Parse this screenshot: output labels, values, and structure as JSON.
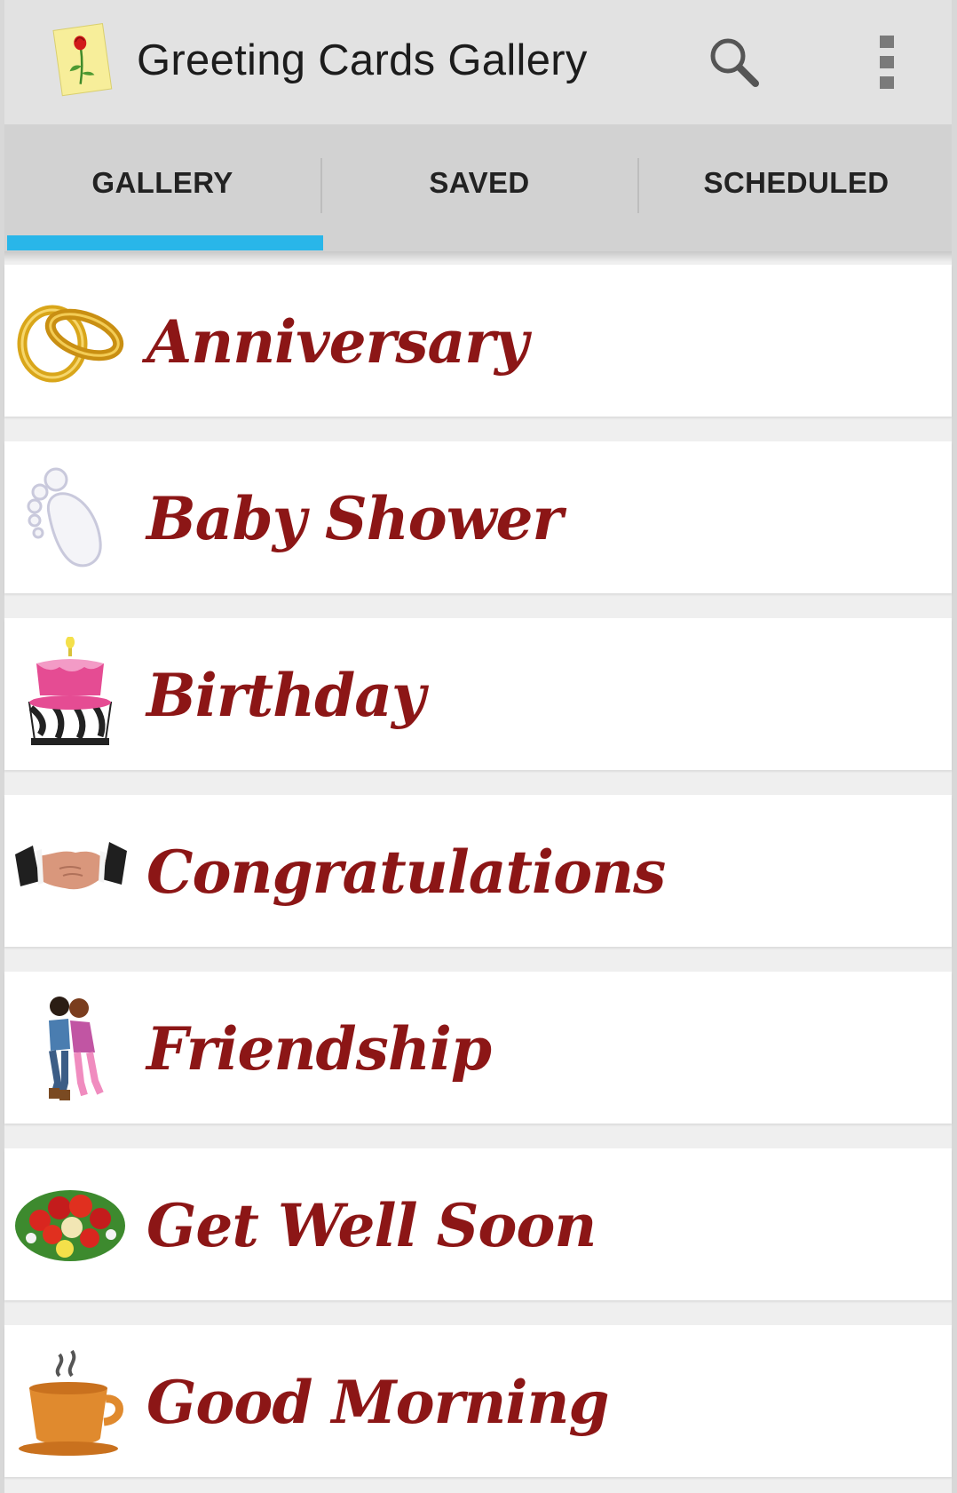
{
  "action_bar": {
    "title": "Greeting Cards Gallery",
    "logo_icon": "rose-card-icon",
    "search_icon": "search-icon",
    "menu_icon": "overflow-menu-icon"
  },
  "tabs": [
    {
      "label": "GALLERY",
      "selected": true
    },
    {
      "label": "SAVED",
      "selected": false
    },
    {
      "label": "SCHEDULED",
      "selected": false
    }
  ],
  "categories": [
    {
      "label": "Anniversary",
      "icon": "wedding-rings-icon"
    },
    {
      "label": "Baby Shower",
      "icon": "baby-footprint-icon"
    },
    {
      "label": "Birthday",
      "icon": "birthday-cake-icon"
    },
    {
      "label": "Congratulations",
      "icon": "handshake-icon"
    },
    {
      "label": "Friendship",
      "icon": "friends-hugging-icon"
    },
    {
      "label": "Get Well Soon",
      "icon": "flower-bouquet-icon"
    },
    {
      "label": "Good Morning",
      "icon": "coffee-cup-icon"
    }
  ],
  "colors": {
    "action_bar_bg": "#e2e2e2",
    "tab_bar_bg": "#d2d2d2",
    "tab_indicator": "#29b6e9",
    "category_text": "#8c1616",
    "list_bg": "#ffffff"
  }
}
